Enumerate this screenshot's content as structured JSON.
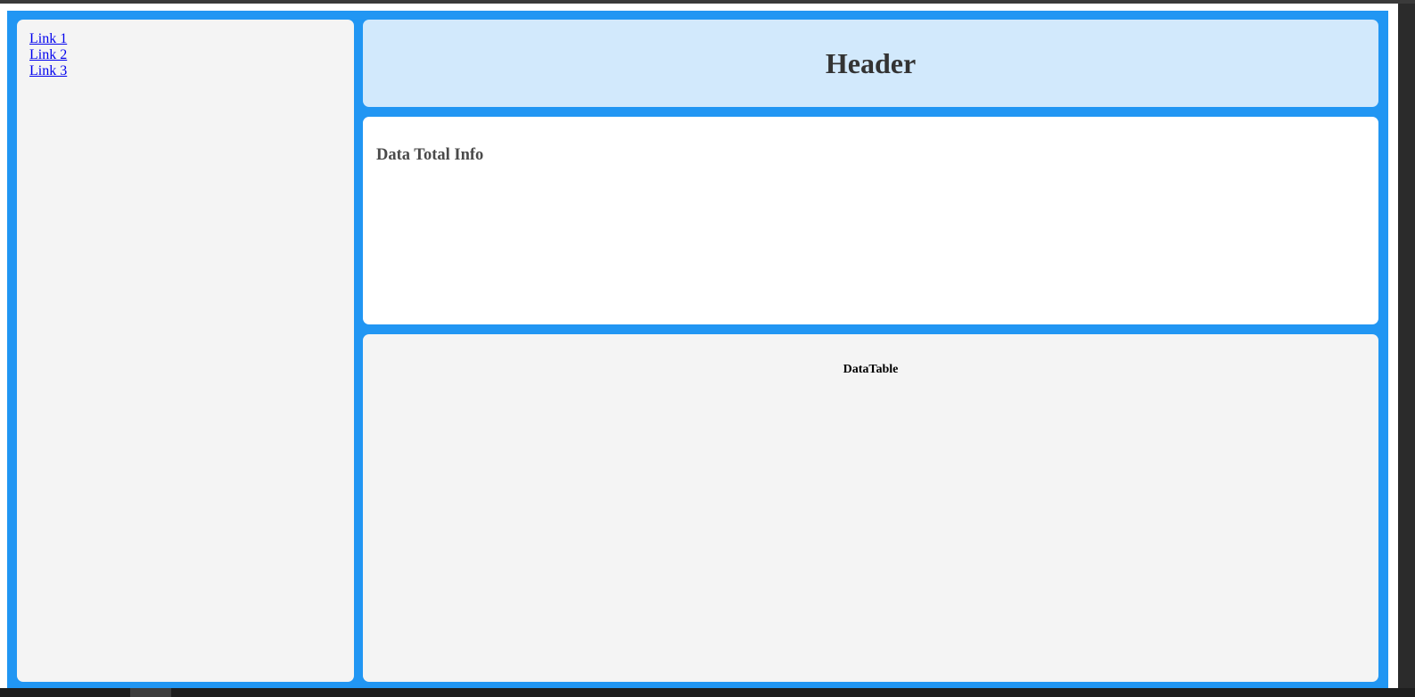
{
  "sidebar": {
    "links": [
      {
        "label": "Link 1"
      },
      {
        "label": "Link 2"
      },
      {
        "label": "Link 3"
      }
    ]
  },
  "header": {
    "title": "Header"
  },
  "info": {
    "title": "Data Total Info"
  },
  "table": {
    "caption": "DataTable"
  },
  "colors": {
    "frame": "#2196f3",
    "header_bg": "#d2e9fc",
    "panel_bg": "#f4f4f4",
    "link": "#0000ee"
  }
}
